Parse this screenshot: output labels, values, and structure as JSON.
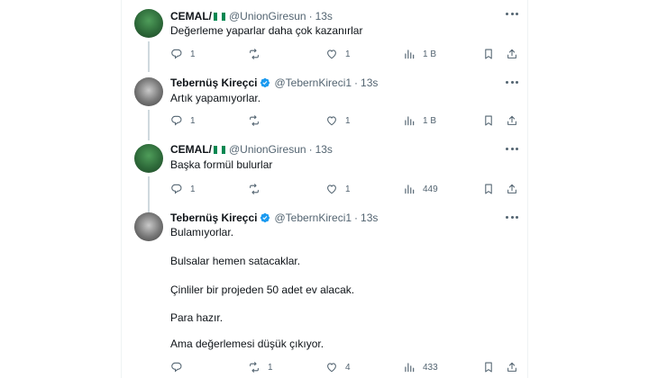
{
  "users": {
    "cemal": {
      "name": "CEMAL/",
      "handle": "@UnionGiresun",
      "flag_colors": [
        "#008751",
        "#ffffff",
        "#008751"
      ]
    },
    "tebernus": {
      "name": "Tebernüş Kireçci",
      "handle": "@TebernKireci1",
      "verified_color": "#1d9bf0"
    }
  },
  "separator": "·",
  "tweets": [
    {
      "time": "13s",
      "lines": [
        "Değerleme yaparlar daha çok kazanırlar"
      ],
      "reply_count": "1",
      "retweet_count": "",
      "like_count": "1",
      "view_count": "1 B"
    },
    {
      "time": "13s",
      "lines": [
        "Artık yapamıyorlar."
      ],
      "reply_count": "1",
      "retweet_count": "",
      "like_count": "1",
      "view_count": "1 B"
    },
    {
      "time": "13s",
      "lines": [
        "Başka formül bulurlar"
      ],
      "reply_count": "1",
      "retweet_count": "",
      "like_count": "1",
      "view_count": "449"
    },
    {
      "time": "13s",
      "lines": [
        "Bulamıyorlar.",
        "Bulsalar hemen satacaklar.",
        "Çinliler bir projeden 50 adet ev alacak.",
        "Para hazır.",
        "Ama değerlemesi düşük çıkıyor."
      ],
      "reply_count": "",
      "retweet_count": "1",
      "like_count": "4",
      "view_count": "433"
    }
  ],
  "icons": {
    "reply": "reply-icon",
    "retweet": "retweet-icon",
    "like": "heart-icon",
    "views": "views-icon",
    "bookmark": "bookmark-icon",
    "share": "share-icon",
    "more": "more-icon",
    "verified": "verified-badge-icon"
  }
}
